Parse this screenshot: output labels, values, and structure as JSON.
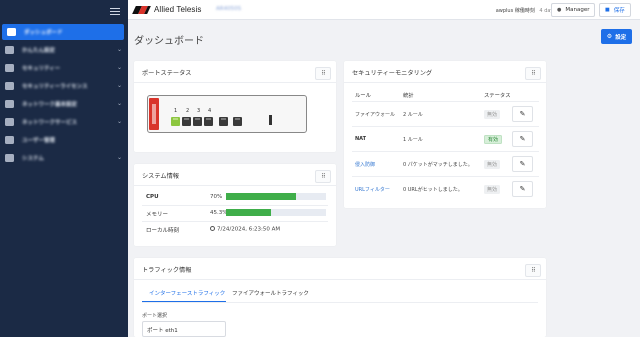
{
  "sidebar": {
    "items": [
      {
        "label": "ダッシュボード",
        "active": true,
        "chevron": false
      },
      {
        "label": "かんたん設定",
        "active": false,
        "chevron": true
      },
      {
        "label": "セキュリティー",
        "active": false,
        "chevron": true
      },
      {
        "label": "セキュリティーライセンス",
        "active": false,
        "chevron": true
      },
      {
        "label": "ネットワーク基本設定",
        "active": false,
        "chevron": true
      },
      {
        "label": "ネットワークサービス",
        "active": false,
        "chevron": true
      },
      {
        "label": "ユーザー管理",
        "active": false,
        "chevron": false
      },
      {
        "label": "システム",
        "active": false,
        "chevron": true
      }
    ],
    "chevron_glyph": "⌄"
  },
  "topbar": {
    "brand": "Allied Telesis",
    "model": "AR4050S",
    "user": "awplus",
    "uptime_label": "稼働時刻",
    "uptime": "4 days 11:35",
    "manager_label": "Manager",
    "save_label": "保存",
    "user_icon": "user-icon",
    "save_icon": "save-icon"
  },
  "page": {
    "title": "ダッシュボード",
    "settings_label": "設定",
    "settings_icon": "gear-icon"
  },
  "port_status": {
    "title": "ポートステータス",
    "port_numbers": [
      "1",
      "2",
      "3",
      "4"
    ],
    "ports_up": [
      true,
      false,
      false,
      false,
      false,
      false
    ]
  },
  "system_info": {
    "title": "システム情報",
    "rows": [
      {
        "label": "CPU",
        "value": "70%",
        "bar": 0.7
      },
      {
        "label": "メモリー",
        "value": "45.3%",
        "bar": 0.453
      },
      {
        "label": "ローカル時刻",
        "value": "7/24/2024, 6:23:50 AM"
      }
    ]
  },
  "security_monitoring": {
    "title": "セキュリティーモニタリング",
    "headers": {
      "rule": "ルール",
      "stats": "統計",
      "status": "ステータス"
    },
    "rows": [
      {
        "rule": "ファイアウォール",
        "stats": "2 ルール",
        "status": "無効",
        "enabled": false,
        "link": false,
        "bold": false
      },
      {
        "rule": "NAT",
        "stats": "1 ルール",
        "status": "有効",
        "enabled": true,
        "link": false,
        "bold": true
      },
      {
        "rule": "侵入防御",
        "stats": "0 パケットがマッチしました。",
        "status": "無効",
        "enabled": false,
        "link": true,
        "bold": false
      },
      {
        "rule": "URLフィルター",
        "stats": "0 URLがヒットしました。",
        "status": "無効",
        "enabled": false,
        "link": true,
        "bold": false
      }
    ]
  },
  "traffic": {
    "title": "トラフィック情報",
    "tabs": [
      "インターフェーストラフィック",
      "ファイアウォールトラフィック"
    ],
    "active_tab": 0,
    "port_select_label": "ポート選択",
    "port_select_value": "ポート eth1"
  },
  "colors": {
    "sidebar_bg": "#1b2a45",
    "accent": "#1e6fe8",
    "bar_green": "#3fae4a",
    "port_up": "#8cc63f",
    "brand_red": "#d9342b"
  }
}
